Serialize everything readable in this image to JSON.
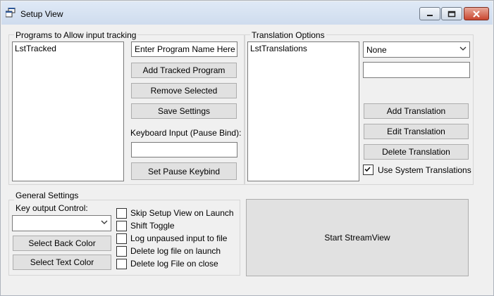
{
  "window": {
    "title": "Setup View"
  },
  "tracked": {
    "group_label": "Programs to Allow input tracking",
    "list_items": [
      "LstTracked"
    ],
    "program_name_value": "Enter Program Name Here",
    "add_label": "Add Tracked Program",
    "remove_label": "Remove Selected",
    "save_label": "Save Settings",
    "keyboard_label": "Keyboard Input (Pause Bind):",
    "pause_value": "",
    "set_pause_label": "Set Pause Keybind"
  },
  "translation": {
    "group_label": "Translation Options",
    "list_items": [
      "LstTranslations"
    ],
    "dropdown_value": "None",
    "text_value": "",
    "add_label": "Add Translation",
    "edit_label": "Edit Translation",
    "delete_label": "Delete Translation",
    "system_checkbox_label": "Use System Translations",
    "system_checked": true
  },
  "general": {
    "group_label": "General Settings",
    "key_output_label": "Key output Control:",
    "key_output_value": "",
    "back_color_label": "Select Back Color",
    "text_color_label": "Select Text Color",
    "checkboxes": [
      {
        "label": "Skip Setup View on Launch",
        "checked": false
      },
      {
        "label": "Shift Toggle",
        "checked": false
      },
      {
        "label": "Log unpaused input to file",
        "checked": false
      },
      {
        "label": "Delete log file on launch",
        "checked": false
      },
      {
        "label": "Delete log File on close",
        "checked": false
      }
    ]
  },
  "start_label": "Start StreamView"
}
